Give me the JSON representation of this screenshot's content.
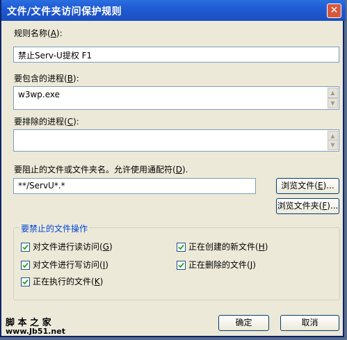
{
  "window": {
    "title": "文件/文件夹访问保护规则",
    "close_glyph": "✕"
  },
  "rule_name": {
    "label_prefix": "规则名称(",
    "label_key": "A",
    "label_suffix": "):",
    "value": "禁止Serv-U提权 F1"
  },
  "include": {
    "label_prefix": "要包含的进程(",
    "label_key": "B",
    "label_suffix": "):",
    "value": "w3wp.exe"
  },
  "exclude": {
    "label_prefix": "要排除的进程(",
    "label_key": "C",
    "label_suffix": "):",
    "value": ""
  },
  "block_files": {
    "label_prefix": "要阻止的文件或文件夹名。允许使用通配符(",
    "label_key": "D",
    "label_suffix": ").",
    "value": "**/ServU*.*",
    "browse_file_prefix": "浏览文件(",
    "browse_file_key": "E",
    "browse_file_suffix": ")...",
    "browse_folder_prefix": "浏览文件夹(",
    "browse_folder_key": "F",
    "browse_folder_suffix": ")..."
  },
  "operations": {
    "group_title": "要禁止的文件操作",
    "read": {
      "prefix": "对文件进行读访问(",
      "key": "G",
      "suffix": ")"
    },
    "write": {
      "prefix": "对文件进行写访问(",
      "key": "I",
      "suffix": ")"
    },
    "execute": {
      "prefix": "正在执行的文件(",
      "key": "K",
      "suffix": ")"
    },
    "create": {
      "prefix": "正在创建的新文件(",
      "key": "H",
      "suffix": ")"
    },
    "delete": {
      "prefix": "正在删除的文件(",
      "key": "J",
      "suffix": ")"
    }
  },
  "buttons": {
    "ok": "确定",
    "cancel": "取消"
  },
  "watermark": {
    "line1": "脚 本 之 家",
    "line2": "www.Jb51.net"
  }
}
